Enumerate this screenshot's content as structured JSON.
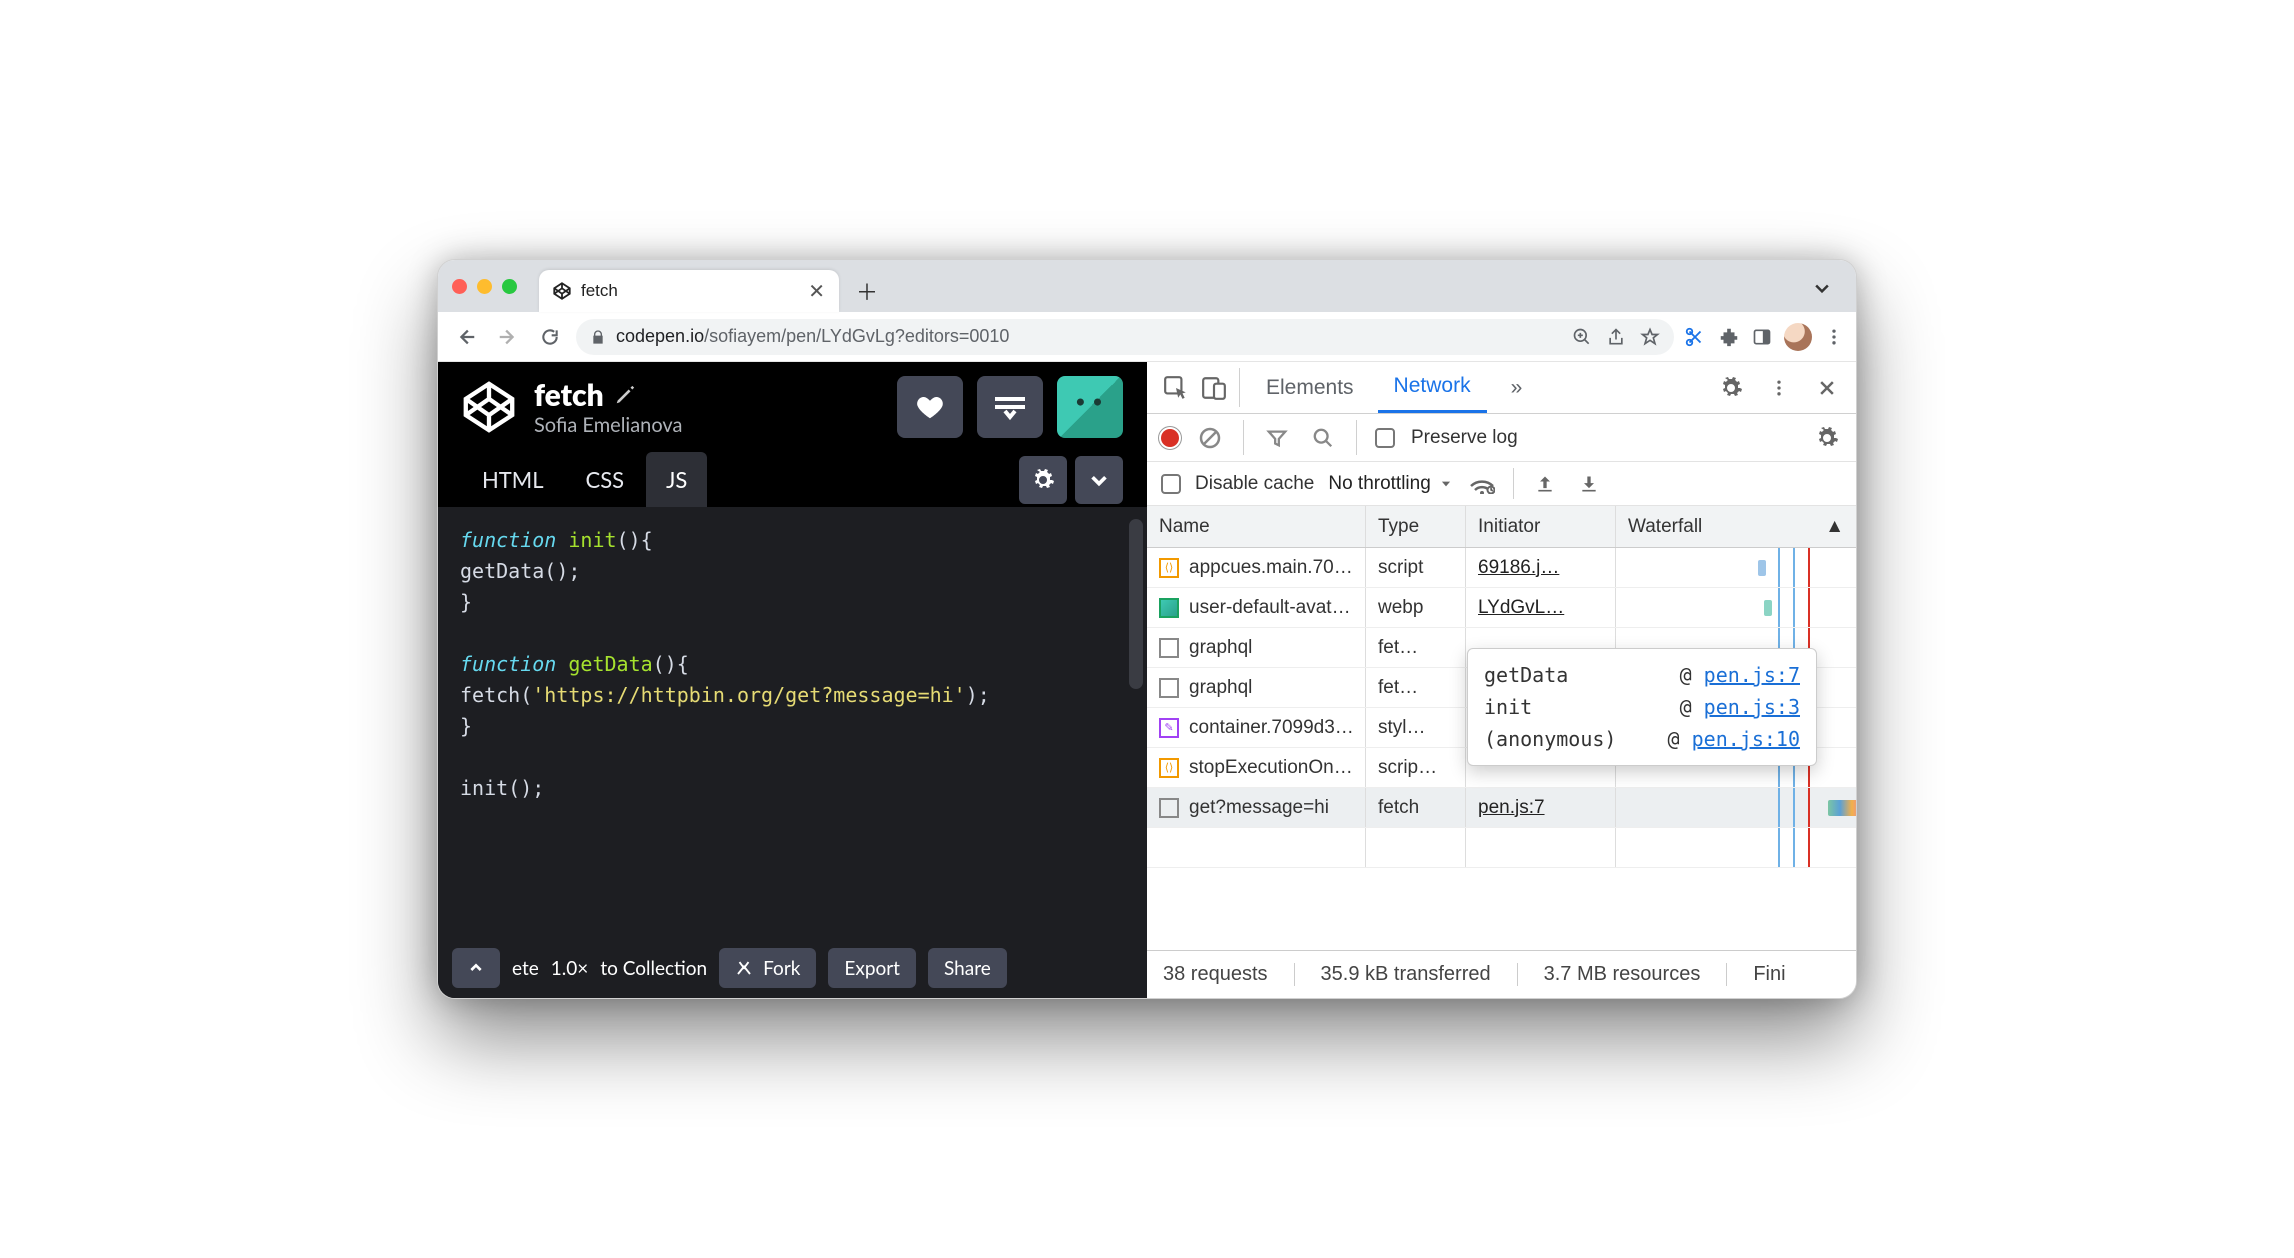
{
  "browser": {
    "tab_title": "fetch",
    "url_host": "codepen.io",
    "url_path": "/sofiayem/pen/LYdGvLg?editors=0010"
  },
  "codepen": {
    "title": "fetch",
    "author": "Sofia Emelianova",
    "tabs": {
      "html": "HTML",
      "css": "CSS",
      "js": "JS"
    },
    "code_lines": [
      [
        {
          "t": "kw",
          "v": "function "
        },
        {
          "t": "fn",
          "v": "init"
        },
        {
          "t": "",
          "v": "(){"
        }
      ],
      [
        {
          "t": "",
          "v": "  getData();"
        }
      ],
      [
        {
          "t": "",
          "v": "}"
        }
      ],
      [
        {
          "t": "",
          "v": ""
        }
      ],
      [
        {
          "t": "kw",
          "v": "function "
        },
        {
          "t": "fn",
          "v": "getData"
        },
        {
          "t": "",
          "v": "(){"
        }
      ],
      [
        {
          "t": "",
          "v": "  fetch("
        },
        {
          "t": "str",
          "v": "'https://httpbin.org/get?message=hi'"
        },
        {
          "t": "",
          "v": ");"
        }
      ],
      [
        {
          "t": "",
          "v": "}"
        }
      ],
      [
        {
          "t": "",
          "v": ""
        }
      ],
      [
        {
          "t": "",
          "v": "init();"
        }
      ]
    ],
    "footer": {
      "delete_fragment": "ete",
      "zoom": "1.0×",
      "collection": "to Collection",
      "fork": "Fork",
      "export": "Export",
      "share": "Share"
    }
  },
  "devtools": {
    "tabs": {
      "elements": "Elements",
      "network": "Network",
      "more": "»"
    },
    "preserve_log": "Preserve log",
    "disable_cache": "Disable cache",
    "throttling": "No throttling",
    "columns": {
      "name": "Name",
      "type": "Type",
      "initiator": "Initiator",
      "waterfall": "Waterfall"
    },
    "rows": [
      {
        "icon": "script",
        "name": "appcues.main.70…",
        "type": "script",
        "initiator": "69186.j…"
      },
      {
        "icon": "img",
        "name": "user-default-avat…",
        "type": "webp",
        "initiator": "LYdGvL…"
      },
      {
        "icon": "blank",
        "name": "graphql",
        "type": "fet…",
        "initiator": ""
      },
      {
        "icon": "blank",
        "name": "graphql",
        "type": "fet…",
        "initiator": ""
      },
      {
        "icon": "style",
        "name": "container.7099d3…",
        "type": "styl…",
        "initiator": ""
      },
      {
        "icon": "script",
        "name": "stopExecutionOn…",
        "type": "scrip…",
        "initiator": ""
      },
      {
        "icon": "blank",
        "name": "get?message=hi",
        "type": "fetch",
        "initiator": "pen.js:7",
        "selected": true
      }
    ],
    "tooltip": [
      {
        "fn": "getData",
        "loc": "pen.js:7"
      },
      {
        "fn": "init",
        "loc": "pen.js:3"
      },
      {
        "fn": "(anonymous)",
        "loc": "pen.js:10"
      }
    ],
    "status": {
      "requests": "38 requests",
      "transferred": "35.9 kB transferred",
      "resources": "3.7 MB resources",
      "finish": "Fini"
    }
  }
}
